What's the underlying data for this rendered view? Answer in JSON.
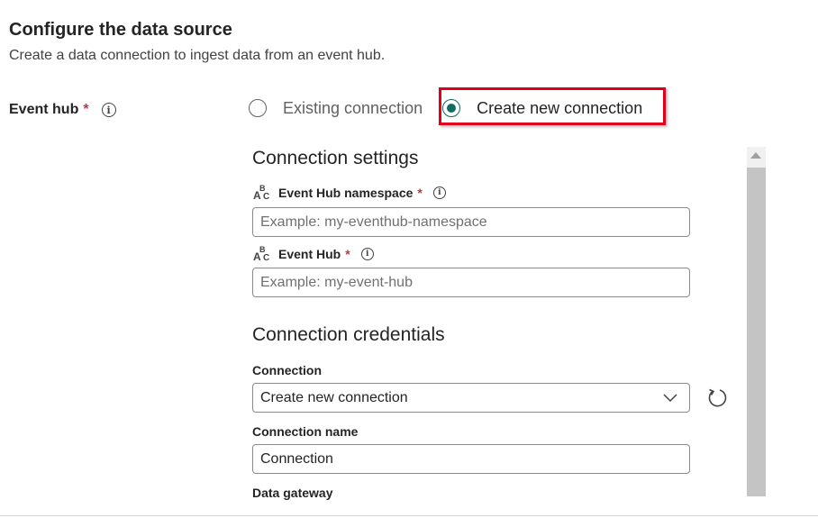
{
  "header": {
    "title": "Configure the data source",
    "subtitle": "Create a data connection to ingest data from an event hub."
  },
  "event_hub": {
    "label": "Event hub",
    "required_mark": "*",
    "info_icon": "i",
    "options": [
      {
        "label": "Existing connection",
        "selected": false
      },
      {
        "label": "Create new connection",
        "selected": true
      }
    ]
  },
  "connection_settings": {
    "title": "Connection settings",
    "namespace": {
      "label": "Event Hub namespace",
      "required_mark": "*",
      "value": "",
      "placeholder": "Example: my-eventhub-namespace"
    },
    "event_hub": {
      "label": "Event Hub",
      "required_mark": "*",
      "value": "",
      "placeholder": "Example: my-event-hub"
    }
  },
  "connection_credentials": {
    "title": "Connection credentials",
    "connection": {
      "label": "Connection",
      "selected": "Create new connection"
    },
    "connection_name": {
      "label": "Connection name",
      "value": "Connection"
    },
    "data_gateway": {
      "label": "Data gateway"
    }
  },
  "icons": {
    "abc_glyph": {
      "a": "A",
      "b": "B",
      "c": "C"
    },
    "info": "info-icon",
    "refresh": "refresh-icon",
    "dropdown": "chevron-down-icon"
  },
  "colors": {
    "accent": "#0f6c5e",
    "required": "#c4314b",
    "highlight": "#e0001b"
  }
}
